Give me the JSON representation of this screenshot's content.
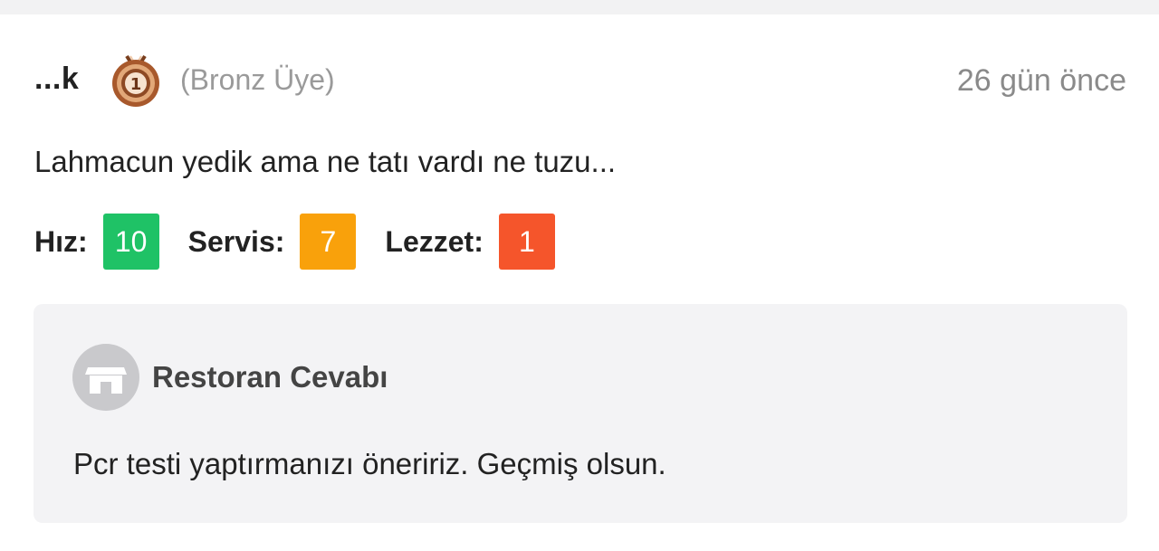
{
  "review": {
    "username": "...k",
    "badge_icon": "bronze-medal-icon",
    "member_level": "(Bronz Üye)",
    "time_ago": "26 gün önce",
    "comment": "Lahmacun yedik ama ne tatı vardı ne tuzu...",
    "ratings": [
      {
        "label": "Hız:",
        "value": "10",
        "color": "#1fc266"
      },
      {
        "label": "Servis:",
        "value": "7",
        "color": "#f9a10b"
      },
      {
        "label": "Lezzet:",
        "value": "1",
        "color": "#f5552b"
      }
    ]
  },
  "restaurant_reply": {
    "icon": "store-icon",
    "title": "Restoran Cevabı",
    "text": "Pcr testi yaptırmanızı öneririz. Geçmiş olsun."
  },
  "colors": {
    "medal_bronze": "#b86a3c",
    "reply_background": "#f3f3f5"
  }
}
